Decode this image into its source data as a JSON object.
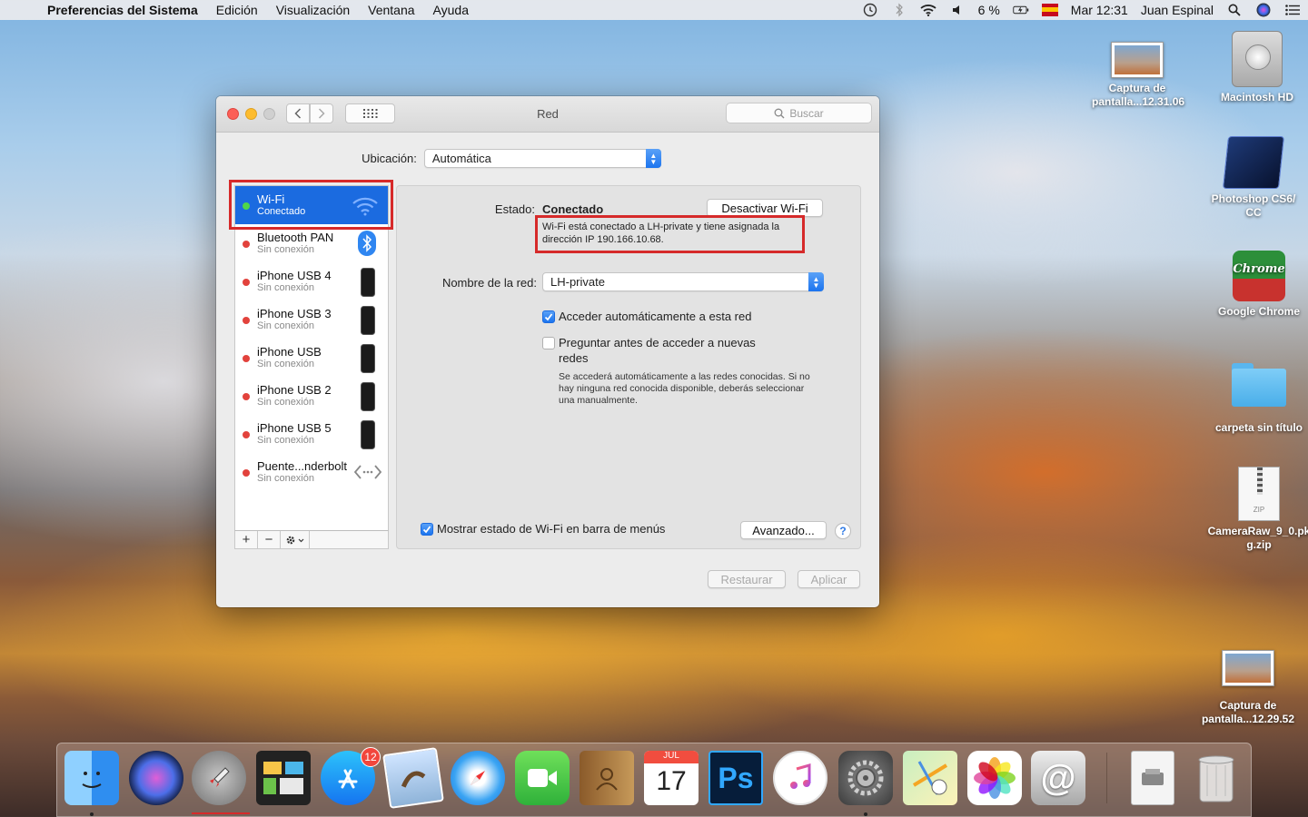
{
  "menubar": {
    "app_name": "Preferencias del Sistema",
    "items": [
      "Edición",
      "Visualización",
      "Ventana",
      "Ayuda"
    ],
    "battery": "6 %",
    "clock": "Mar 12:31",
    "user": "Juan Espinal"
  },
  "desktop": {
    "icons": [
      {
        "label": "Captura de pantalla...12.31.06",
        "icon": "screenshot-thumbnail"
      },
      {
        "label": "Macintosh HD",
        "icon": "hard-drive"
      },
      {
        "label": "Photoshop CS6/ CC",
        "icon": "photoshop-folder"
      },
      {
        "label": "Google Chrome",
        "icon": "chrome-app"
      },
      {
        "label": "carpeta sin título",
        "icon": "folder"
      },
      {
        "label": "CameraRaw_9_0.pkg.zip",
        "icon": "zip-file"
      },
      {
        "label": "Captura de pantalla...12.29.52",
        "icon": "screenshot-thumbnail"
      }
    ],
    "chrome_icon_text": "Chrome",
    "zip_icon_text": "ZIP"
  },
  "window": {
    "title": "Red",
    "search_placeholder": "Buscar",
    "location_label": "Ubicación:",
    "location_value": "Automática"
  },
  "services": [
    {
      "name": "Wi-Fi",
      "status": "Conectado",
      "selected": true,
      "icon": "wifi-icon"
    },
    {
      "name": "Bluetooth PAN",
      "status": "Sin conexión",
      "icon": "bluetooth-icon"
    },
    {
      "name": "iPhone USB 4",
      "status": "Sin conexión",
      "icon": "iphone-icon"
    },
    {
      "name": "iPhone USB 3",
      "status": "Sin conexión",
      "icon": "iphone-icon"
    },
    {
      "name": "iPhone USB",
      "status": "Sin conexión",
      "icon": "iphone-icon"
    },
    {
      "name": "iPhone USB 2",
      "status": "Sin conexión",
      "icon": "iphone-icon"
    },
    {
      "name": "iPhone USB 5",
      "status": "Sin conexión",
      "icon": "iphone-icon"
    },
    {
      "name": "Puente...nderbolt",
      "status": "Sin conexión",
      "icon": "thunderbolt-bridge-icon"
    }
  ],
  "detail": {
    "status_label": "Estado:",
    "status_value": "Conectado",
    "toggle_button": "Desactivar Wi-Fi",
    "status_description": "Wi-Fi está conectado a LH-private y tiene asignada la dirección IP 190.166.10.68.",
    "network_name_label": "Nombre de la red:",
    "network_name_value": "LH-private",
    "auto_join_label": "Acceder automáticamente a esta red",
    "auto_join_checked": true,
    "ask_join_label": "Preguntar antes de acceder a nuevas redes",
    "ask_join_checked": false,
    "ask_join_help": "Se accederá automáticamente a las redes conocidas. Si no hay ninguna red conocida disponible, deberás seleccionar una manualmente.",
    "show_status_label": "Mostrar estado de Wi-Fi en barra de menús",
    "show_status_checked": true,
    "advanced_button": "Avanzado...",
    "help_button": "?"
  },
  "footer": {
    "revert_button": "Restaurar",
    "apply_button": "Aplicar"
  },
  "dock": {
    "items": [
      "Finder",
      "Siri",
      "Launchpad",
      "Mission Control",
      "App Store",
      "Preview",
      "Safari",
      "FaceTime",
      "Contactos",
      "Calendario",
      "Photoshop",
      "iTunes",
      "Preferencias del Sistema",
      "Mapas",
      "Fotos",
      "Mail",
      "Documento",
      "Papelera"
    ],
    "app_store_badge": "12",
    "calendar_month": "JUL",
    "calendar_day": "17",
    "photoshop_text": "Ps"
  },
  "colors": {
    "selection_blue": "#1b6be0",
    "connected_green": "#4fd64a",
    "disconnected_red": "#e2423c",
    "highlight_red": "#d62a2a"
  }
}
